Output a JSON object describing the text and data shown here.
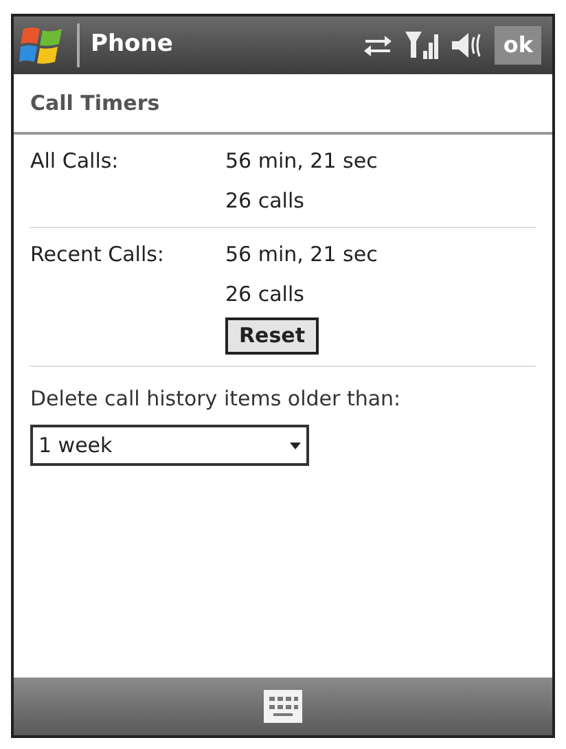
{
  "title_bar": {
    "title": "Phone",
    "ok_button": "ok"
  },
  "header": "Call Timers",
  "timers": [
    {
      "label": "All Calls:",
      "duration": "56 min, 21 sec",
      "count": "26 calls"
    },
    {
      "label": "Recent Calls:",
      "duration": "56 min, 21 sec",
      "count": "26 calls",
      "button": "Reset"
    }
  ],
  "history": {
    "label": "Delete call history items older than:",
    "value": "1 week"
  }
}
